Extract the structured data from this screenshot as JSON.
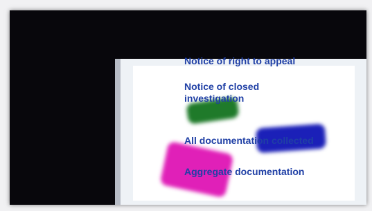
{
  "steps": [
    {
      "label": "Notice of right to appeal"
    },
    {
      "label": "Notice of closed investigation"
    },
    {
      "label": "All documentation collected"
    },
    {
      "label": "Aggregate documentation"
    }
  ]
}
